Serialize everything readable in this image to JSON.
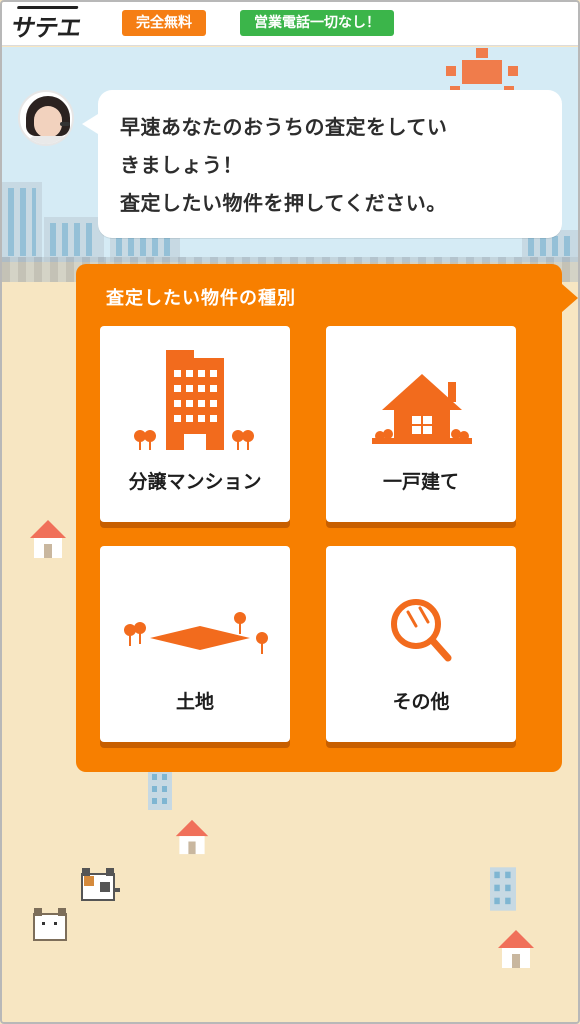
{
  "header": {
    "logo_text": "サテエ",
    "badges": [
      {
        "label": "完全無料",
        "color": "#f57e14"
      },
      {
        "label": "営業電話一切なし！",
        "color": "#3bb54a"
      }
    ]
  },
  "bubble": {
    "lines": [
      "早速あなたのおうちの査定をしてい",
      "きましょう！",
      "査定したい物件を押してください。"
    ]
  },
  "panel": {
    "title": "査定したい物件の種別",
    "accent": "#f77f00",
    "options": [
      {
        "label": "分譲マンション",
        "icon": "apartment-icon"
      },
      {
        "label": "一戸建て",
        "icon": "house-icon"
      },
      {
        "label": "土地",
        "icon": "land-icon"
      },
      {
        "label": "その他",
        "icon": "magnifier-icon"
      }
    ]
  }
}
